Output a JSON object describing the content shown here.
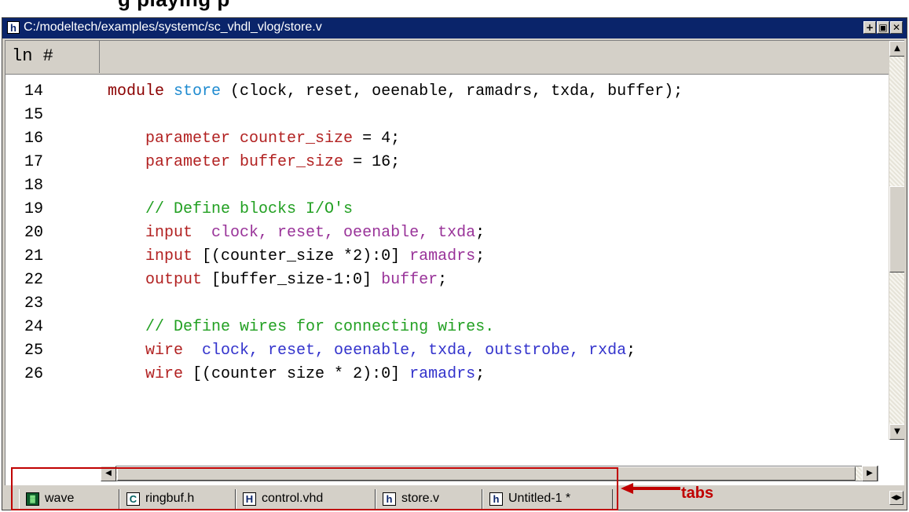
{
  "heading_fragment": "g                 playing                p",
  "window": {
    "title": "C:/modeltech/examples/systemc/sc_vhdl_vlog/store.v",
    "title_icon": "h",
    "controls": [
      "+",
      "▣",
      "✕"
    ]
  },
  "ruler": {
    "label": "ln #"
  },
  "code_lines": [
    {
      "num": "14",
      "segments": [
        {
          "t": "module ",
          "c": "#8b0000"
        },
        {
          "t": "store",
          "c": "#1f8bd0"
        },
        {
          "t": " (clock, reset, oeenable, ramadrs, txda, buffer);",
          "c": "#000000"
        }
      ]
    },
    {
      "num": "15",
      "segments": []
    },
    {
      "num": "16",
      "segments": [
        {
          "t": "    parameter counter_size",
          "c": "#b22222"
        },
        {
          "t": " = 4;",
          "c": "#000000"
        }
      ]
    },
    {
      "num": "17",
      "segments": [
        {
          "t": "    parameter buffer_size",
          "c": "#b22222"
        },
        {
          "t": " = 16;",
          "c": "#000000"
        }
      ]
    },
    {
      "num": "18",
      "segments": []
    },
    {
      "num": "19",
      "segments": [
        {
          "t": "    // Define blocks I/O's",
          "c": "#22a022"
        }
      ]
    },
    {
      "num": "20",
      "segments": [
        {
          "t": "    input  ",
          "c": "#b22222"
        },
        {
          "t": "clock, reset, oeenable, txda",
          "c": "#993399"
        },
        {
          "t": ";",
          "c": "#000000"
        }
      ]
    },
    {
      "num": "21",
      "segments": [
        {
          "t": "    input ",
          "c": "#b22222"
        },
        {
          "t": "[(counter_size *2):0] ",
          "c": "#000000"
        },
        {
          "t": "ramadrs",
          "c": "#993399"
        },
        {
          "t": ";",
          "c": "#000000"
        }
      ]
    },
    {
      "num": "22",
      "segments": [
        {
          "t": "    output ",
          "c": "#b22222"
        },
        {
          "t": "[buffer_size-1:0] ",
          "c": "#000000"
        },
        {
          "t": "buffer",
          "c": "#993399"
        },
        {
          "t": ";",
          "c": "#000000"
        }
      ]
    },
    {
      "num": "23",
      "segments": []
    },
    {
      "num": "24",
      "segments": [
        {
          "t": "    // Define wires for connecting wires.",
          "c": "#22a022"
        }
      ]
    },
    {
      "num": "25",
      "segments": [
        {
          "t": "    wire  ",
          "c": "#b22222"
        },
        {
          "t": "clock, reset, oeenable, txda, outstrobe, rxda",
          "c": "#3333cc"
        },
        {
          "t": ";",
          "c": "#000000"
        }
      ]
    },
    {
      "num": "26",
      "segments": [
        {
          "t": "    wire ",
          "c": "#b22222"
        },
        {
          "t": "[(counter size * 2):0] ",
          "c": "#000000"
        },
        {
          "t": "ramadrs",
          "c": "#3333cc"
        },
        {
          "t": ";",
          "c": "#000000"
        }
      ]
    }
  ],
  "tabs": [
    {
      "label": "wave",
      "icon": "wave-icon",
      "glyph": "▓"
    },
    {
      "label": "ringbuf.h",
      "icon": "c-file-icon",
      "glyph": "C"
    },
    {
      "label": "control.vhd",
      "icon": "vhdl-file-icon",
      "glyph": "H"
    },
    {
      "label": "store.v",
      "icon": "verilog-file-icon",
      "glyph": "h"
    },
    {
      "label": "Untitled-1 *",
      "icon": "verilog-file-icon",
      "glyph": "h"
    }
  ],
  "annotation": {
    "label": "tabs",
    "color": "#c00000"
  }
}
